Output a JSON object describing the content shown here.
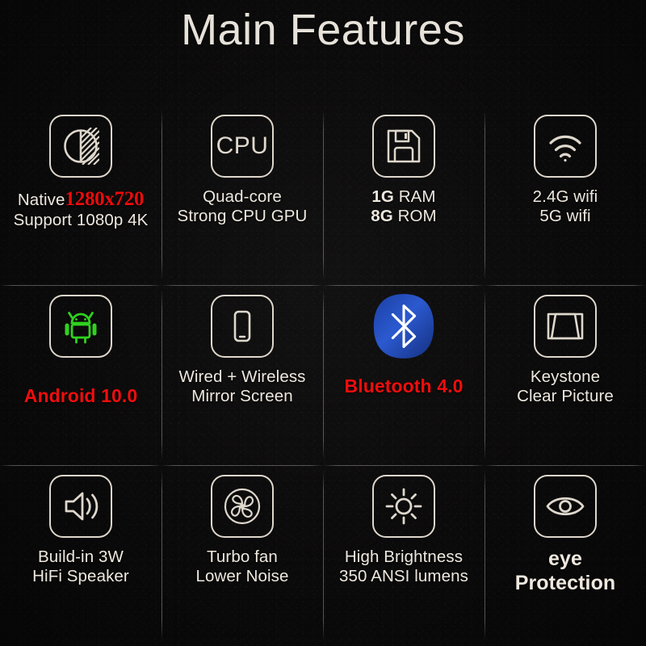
{
  "title": "Main Features",
  "theme": {
    "background": "#0b0a0a",
    "title_color": "#e6e2da",
    "text_color": "#eee8df",
    "accent_red": "#ec0b0b",
    "icon_stroke": "#ded7cc",
    "android_green": "#2fd21f",
    "bluetooth_blue": "#1f48b4"
  },
  "features": [
    {
      "icon": "contrast-resolution-icon",
      "line1_prefix": "Native",
      "line1_accent": "1280x720",
      "line2": "Support 1080p 4K"
    },
    {
      "icon": "cpu-icon",
      "icon_text": "CPU",
      "line1": "Quad-core",
      "line2": "Strong CPU GPU"
    },
    {
      "icon": "floppy-disk-icon",
      "line1_bold": "1G",
      "line1_rest": "RAM",
      "line2_bold": "8G",
      "line2_rest": "ROM"
    },
    {
      "icon": "wifi-icon",
      "line1": "2.4G wifi",
      "line2": "5G wifi"
    },
    {
      "icon": "android-robot-icon",
      "line1": "Android 10.0",
      "line2": ""
    },
    {
      "icon": "smartphone-icon",
      "line1": "Wired + Wireless",
      "line2": "Mirror Screen"
    },
    {
      "icon": "bluetooth-icon",
      "line1": "Bluetooth 4.0",
      "line2": ""
    },
    {
      "icon": "keystone-trapezoid-icon",
      "line1": "Keystone",
      "line2": "Clear Picture"
    },
    {
      "icon": "speaker-icon",
      "line1": "Build-in 3W",
      "line2": "HiFi Speaker"
    },
    {
      "icon": "fan-icon",
      "line1": "Turbo fan",
      "line2": "Lower Noise"
    },
    {
      "icon": "brightness-sun-icon",
      "line1": "High Brightness",
      "line2": "350 ANSI lumens"
    },
    {
      "icon": "eye-icon",
      "line1": "eye",
      "line2": "Protection"
    }
  ]
}
